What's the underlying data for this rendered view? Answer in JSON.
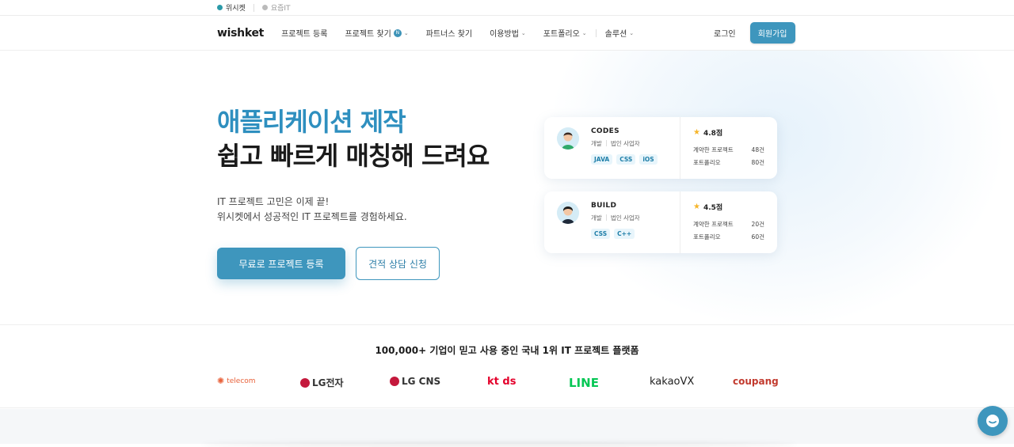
{
  "topbar": {
    "site1": "위시켓",
    "site2": "요즘IT"
  },
  "nav": {
    "logo": "wishket",
    "items": [
      {
        "label": "프로젝트 등록",
        "has_chevron": false
      },
      {
        "label": "프로젝트 찾기",
        "badge": "N",
        "has_chevron": true
      },
      {
        "label": "파트너스 찾기",
        "has_chevron": false
      },
      {
        "label": "이용방법",
        "has_chevron": true
      },
      {
        "label": "포트폴리오",
        "has_chevron": true
      },
      {
        "label": "솔루션",
        "has_chevron": true
      }
    ],
    "login": "로그인",
    "signup": "회원가입"
  },
  "hero": {
    "headline_accent": "애플리케이션 제작",
    "headline_main": "쉽고 빠르게 매칭해 드려요",
    "desc_line1": "IT 프로젝트 고민은 이제 끝!",
    "desc_line2": "위시켓에서 성공적인 IT 프로젝트를 경험하세요.",
    "primary_button": "무료로 프로젝트 등록",
    "secondary_button": "견적 상담 신청"
  },
  "cards": [
    {
      "name": "CODES",
      "role": "개발",
      "type": "법인 사업자",
      "tags": [
        "JAVA",
        "CSS",
        "iOS"
      ],
      "rating": "4.8점",
      "contracts_label": "계약한 프로젝트",
      "contracts_value": "48건",
      "portfolio_label": "포트폴리오",
      "portfolio_value": "80건"
    },
    {
      "name": "BUILD",
      "role": "개발",
      "type": "법인 사업자",
      "tags": [
        "CSS",
        "C++"
      ],
      "rating": "4.5점",
      "contracts_label": "계약한 프로젝트",
      "contracts_value": "20건",
      "portfolio_label": "포트폴리오",
      "portfolio_value": "60건"
    }
  ],
  "trust": {
    "title": "100,000+ 기업이 믿고 사용 중인 국내 1위 IT 프로젝트 플랫폼",
    "logos": [
      {
        "label": "telecom",
        "color": "#e8613a"
      },
      {
        "label": "LG전자",
        "color": "#333333"
      },
      {
        "label": "LG CNS",
        "color": "#333333"
      },
      {
        "label": "kt ds",
        "color": "#e4002b"
      },
      {
        "label": "LINE",
        "color": "#06c755"
      },
      {
        "label": "kakaoVX",
        "color": "#222222"
      },
      {
        "label": "coupang",
        "color": "#c23a2e"
      }
    ]
  },
  "colors": {
    "brand": "#3e96bd",
    "accent_text": "#2e8fbf"
  },
  "icons": {
    "chat": "chat-bubble-icon",
    "star": "star-icon"
  }
}
